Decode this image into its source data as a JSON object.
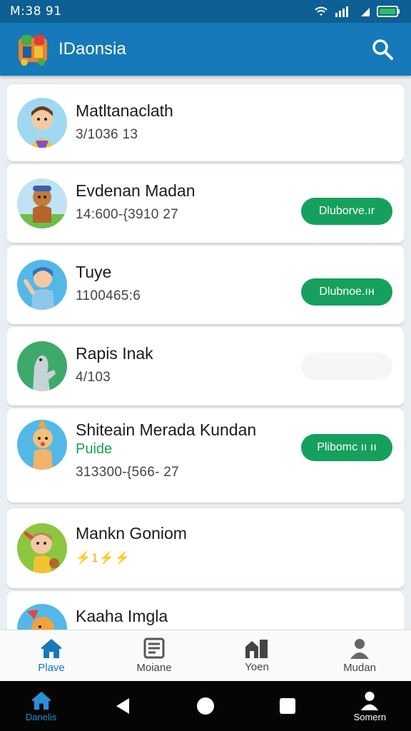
{
  "status_bar": {
    "time": "M:38 91"
  },
  "app_bar": {
    "title": "IDaonsia"
  },
  "contacts": [
    {
      "name": "Matltanaclath",
      "meta": "3/1036 13",
      "button": ""
    },
    {
      "name": "Evdenan Madan",
      "meta": "14:600-{3910 27",
      "button": "Dluborve.ır"
    },
    {
      "name": "Tuye",
      "meta": "1100465:6",
      "button": "Dlubnoe.ıн"
    },
    {
      "name": "Rapis Inak",
      "meta": "4/103",
      "button": ""
    },
    {
      "name": "Shiteain Merada Kundan",
      "subtitle": "Puide",
      "meta": "313300-{566- 27",
      "button": "Plibomc ıı ıı"
    },
    {
      "name": "Mankn Goniom",
      "stars": "⚡1⚡⚡",
      "button": ""
    },
    {
      "name": "Kaaha Imgla",
      "button": ""
    }
  ],
  "bottom_nav": [
    {
      "label": "Plave",
      "icon": "home-icon",
      "active": true
    },
    {
      "label": "Moiane",
      "icon": "document-icon"
    },
    {
      "label": "Yoen",
      "icon": "buildings-icon"
    },
    {
      "label": "Mudan",
      "icon": "person-icon"
    }
  ],
  "system_nav": [
    {
      "label": "Danelis",
      "icon": "home-icon"
    },
    {
      "label": "",
      "icon": "back-icon"
    },
    {
      "label": "",
      "icon": "home-circle-icon"
    },
    {
      "label": "",
      "icon": "recents-icon"
    },
    {
      "label": "Somern",
      "icon": "person-icon"
    }
  ],
  "colors": {
    "app_bar": "#1679b9",
    "status_bar": "#0e5f93",
    "accent_green": "#16a05d",
    "active_blue": "#1679b9"
  }
}
